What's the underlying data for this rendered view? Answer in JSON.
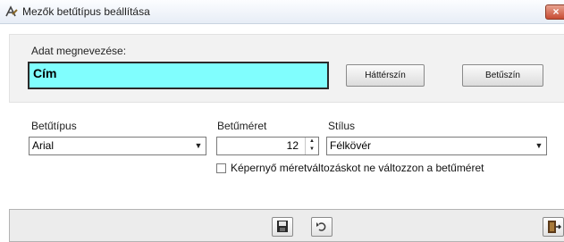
{
  "window": {
    "title": "Mezők betűtípus beállítása",
    "close_glyph": "×"
  },
  "name_section": {
    "label": "Adat megnevezése:",
    "value": "Cím",
    "bg_color": "#80fefe",
    "background_button": "Háttérszín",
    "font_color_button": "Betűszín"
  },
  "font": {
    "family_label": "Betűtípus",
    "family_value": "Arial",
    "size_label": "Betűméret",
    "size_value": "12",
    "style_label": "Stílus",
    "style_value": "Félkövér"
  },
  "checkbox": {
    "label": "Képernyő méretváltozáskot ne változzon a betűméret",
    "checked": false
  },
  "toolbar": {
    "icons": [
      "save-icon",
      "undo-icon",
      "exit-door-icon"
    ]
  }
}
